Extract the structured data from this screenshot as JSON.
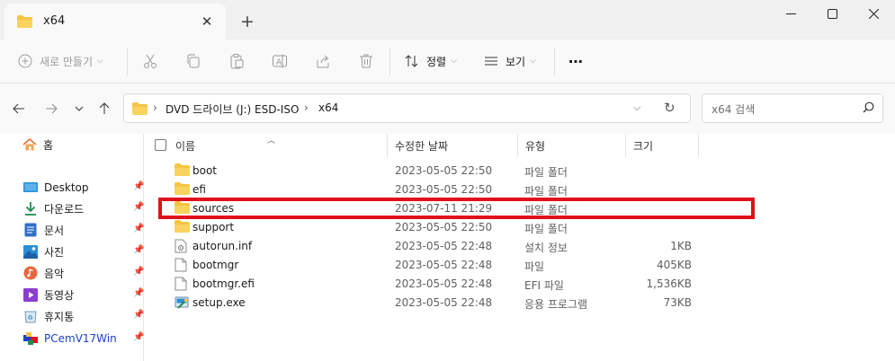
{
  "window": {
    "tab_title": "x64",
    "new_tab_symbol": "+"
  },
  "toolbar": {
    "new_label": "새로 만들기",
    "sort_label": "정렬",
    "view_label": "보기",
    "more_symbol": "⋯"
  },
  "address": {
    "crumbs": [
      "DVD 드라이브 (J:) ESD-ISO",
      "x64"
    ],
    "search_placeholder": "x64 검색"
  },
  "sidebar": {
    "home_label": "홈",
    "items": [
      {
        "label": "Desktop",
        "icon": "desktop-icon"
      },
      {
        "label": "다운로드",
        "icon": "download-icon"
      },
      {
        "label": "문서",
        "icon": "document-icon"
      },
      {
        "label": "사진",
        "icon": "pictures-icon"
      },
      {
        "label": "음악",
        "icon": "music-icon"
      },
      {
        "label": "동영상",
        "icon": "video-icon"
      },
      {
        "label": "휴지통",
        "icon": "recycle-bin-icon"
      },
      {
        "label": "PCemV17Win",
        "icon": "app-folder-icon"
      }
    ]
  },
  "list": {
    "columns": {
      "name": "이름",
      "date": "수정한 날짜",
      "type": "유형",
      "size": "크기"
    },
    "rows": [
      {
        "name": "boot",
        "date": "2023-05-05 22:50",
        "type": "파일 폴더",
        "size": "",
        "icon": "folder-icon"
      },
      {
        "name": "efi",
        "date": "2023-05-05 22:50",
        "type": "파일 폴더",
        "size": "",
        "icon": "folder-icon"
      },
      {
        "name": "sources",
        "date": "2023-07-11 21:29",
        "type": "파일 폴더",
        "size": "",
        "icon": "folder-icon"
      },
      {
        "name": "support",
        "date": "2023-05-05 22:50",
        "type": "파일 폴더",
        "size": "",
        "icon": "folder-icon"
      },
      {
        "name": "autorun.inf",
        "date": "2023-05-05 22:48",
        "type": "설치 정보",
        "size": "1KB",
        "icon": "settings-file-icon"
      },
      {
        "name": "bootmgr",
        "date": "2023-05-05 22:48",
        "type": "파일",
        "size": "405KB",
        "icon": "file-icon"
      },
      {
        "name": "bootmgr.efi",
        "date": "2023-05-05 22:48",
        "type": "EFI 파일",
        "size": "1,536KB",
        "icon": "file-icon"
      },
      {
        "name": "setup.exe",
        "date": "2023-05-05 22:48",
        "type": "응용 프로그램",
        "size": "73KB",
        "icon": "setup-app-icon"
      }
    ]
  },
  "colors": {
    "highlight": "#e0101c",
    "folder": "#f4c542",
    "link": "#1b3fc9"
  }
}
